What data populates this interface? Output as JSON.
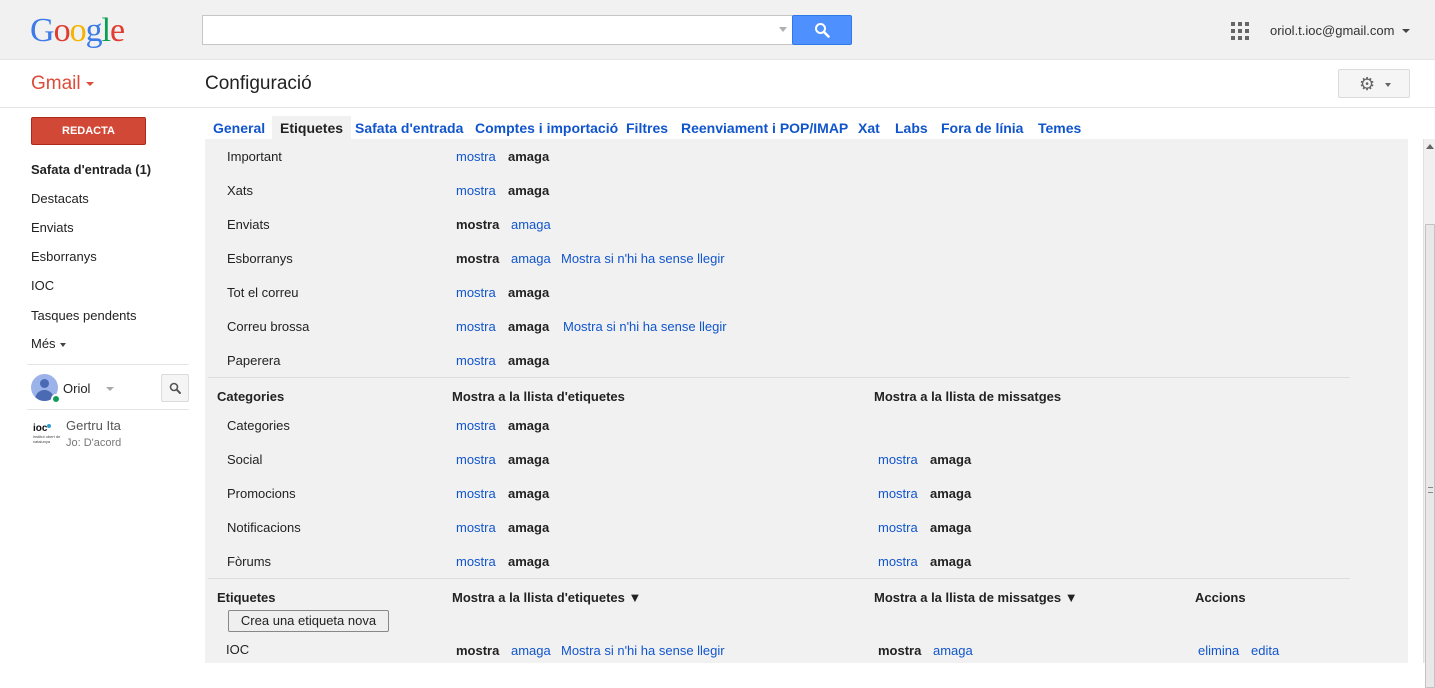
{
  "header": {
    "logo": [
      "G",
      "o",
      "o",
      "g",
      "l",
      "e"
    ],
    "logo_colors": [
      "#3d7ce8",
      "#e03c2f",
      "#f4b400",
      "#3d7ce8",
      "#0a9f54",
      "#e03c2f"
    ],
    "search_value": "",
    "account_email": "oriol.t.ioc@gmail.com"
  },
  "subheader": {
    "app_name": "Gmail",
    "page_title": "Configuració"
  },
  "sidebar": {
    "compose_label": "REDACTA",
    "items": [
      {
        "label": "Safata d'entrada (1)",
        "bold": true
      },
      {
        "label": "Destacats"
      },
      {
        "label": "Enviats"
      },
      {
        "label": "Esborranys"
      },
      {
        "label": "IOC"
      },
      {
        "label": "Tasques pendents"
      },
      {
        "label": "Més"
      }
    ],
    "chat_user": "Oriol",
    "contact": {
      "logo_text": "ioc",
      "logo_sub": "institut obert de catalunya",
      "name": "Gertru Ita",
      "status": "Jo: D'acord"
    }
  },
  "tabs": [
    {
      "label": "General"
    },
    {
      "label": "Etiquetes",
      "active": true
    },
    {
      "label": "Safata d'entrada"
    },
    {
      "label": "Comptes i importació"
    },
    {
      "label": "Filtres"
    },
    {
      "label": "Reenviament i POP/IMAP"
    },
    {
      "label": "Xat"
    },
    {
      "label": "Labs"
    },
    {
      "label": "Fora de línia"
    },
    {
      "label": "Temes"
    }
  ],
  "system_labels": [
    {
      "name": "Important",
      "show": "mostra",
      "hide": "amaga",
      "selected": "amaga"
    },
    {
      "name": "Xats",
      "show": "mostra",
      "hide": "amaga",
      "selected": "amaga"
    },
    {
      "name": "Enviats",
      "show": "mostra",
      "hide": "amaga",
      "selected": "mostra"
    },
    {
      "name": "Esborranys",
      "show": "mostra",
      "hide": "amaga",
      "selected": "mostra",
      "unread": "Mostra si n'hi ha sense llegir"
    },
    {
      "name": "Tot el correu",
      "show": "mostra",
      "hide": "amaga",
      "selected": "amaga"
    },
    {
      "name": "Correu brossa",
      "show": "mostra",
      "hide": "amaga",
      "selected": "amaga",
      "unread": "Mostra si n'hi ha sense llegir"
    },
    {
      "name": "Paperera",
      "show": "mostra",
      "hide": "amaga",
      "selected": "amaga"
    }
  ],
  "categories_section": {
    "heading": "Categories",
    "col_label_list": "Mostra a la llista d'etiquetes",
    "col_message_list": "Mostra a la llista de missatges",
    "rows": [
      {
        "name": "Categories",
        "show": "mostra",
        "hide": "amaga",
        "selected": "amaga"
      },
      {
        "name": "Social",
        "show": "mostra",
        "hide": "amaga",
        "selected": "amaga",
        "msg_show": "mostra",
        "msg_hide": "amaga",
        "msg_selected": "amaga"
      },
      {
        "name": "Promocions",
        "show": "mostra",
        "hide": "amaga",
        "selected": "amaga",
        "msg_show": "mostra",
        "msg_hide": "amaga",
        "msg_selected": "amaga"
      },
      {
        "name": "Notificacions",
        "show": "mostra",
        "hide": "amaga",
        "selected": "amaga",
        "msg_show": "mostra",
        "msg_hide": "amaga",
        "msg_selected": "amaga"
      },
      {
        "name": "Fòrums",
        "show": "mostra",
        "hide": "amaga",
        "selected": "amaga",
        "msg_show": "mostra",
        "msg_hide": "amaga",
        "msg_selected": "amaga"
      }
    ]
  },
  "labels_section": {
    "heading": "Etiquetes",
    "col_label_list": "Mostra a la llista d'etiquetes ▼",
    "col_message_list": "Mostra a la llista de missatges ▼",
    "col_actions": "Accions",
    "new_label_button": "Crea una etiqueta nova",
    "rows": [
      {
        "name": "IOC",
        "show": "mostra",
        "hide": "amaga",
        "selected": "mostra",
        "unread": "Mostra si n'hi ha sense llegir",
        "msg_show": "mostra",
        "msg_hide": "amaga",
        "msg_selected": "mostra",
        "remove": "elimina",
        "edit": "edita"
      }
    ]
  },
  "colors": {
    "link": "#1155cc",
    "compose": "#d14836",
    "search_button": "#4d90fe",
    "gmail_red": "#dd4b39"
  }
}
